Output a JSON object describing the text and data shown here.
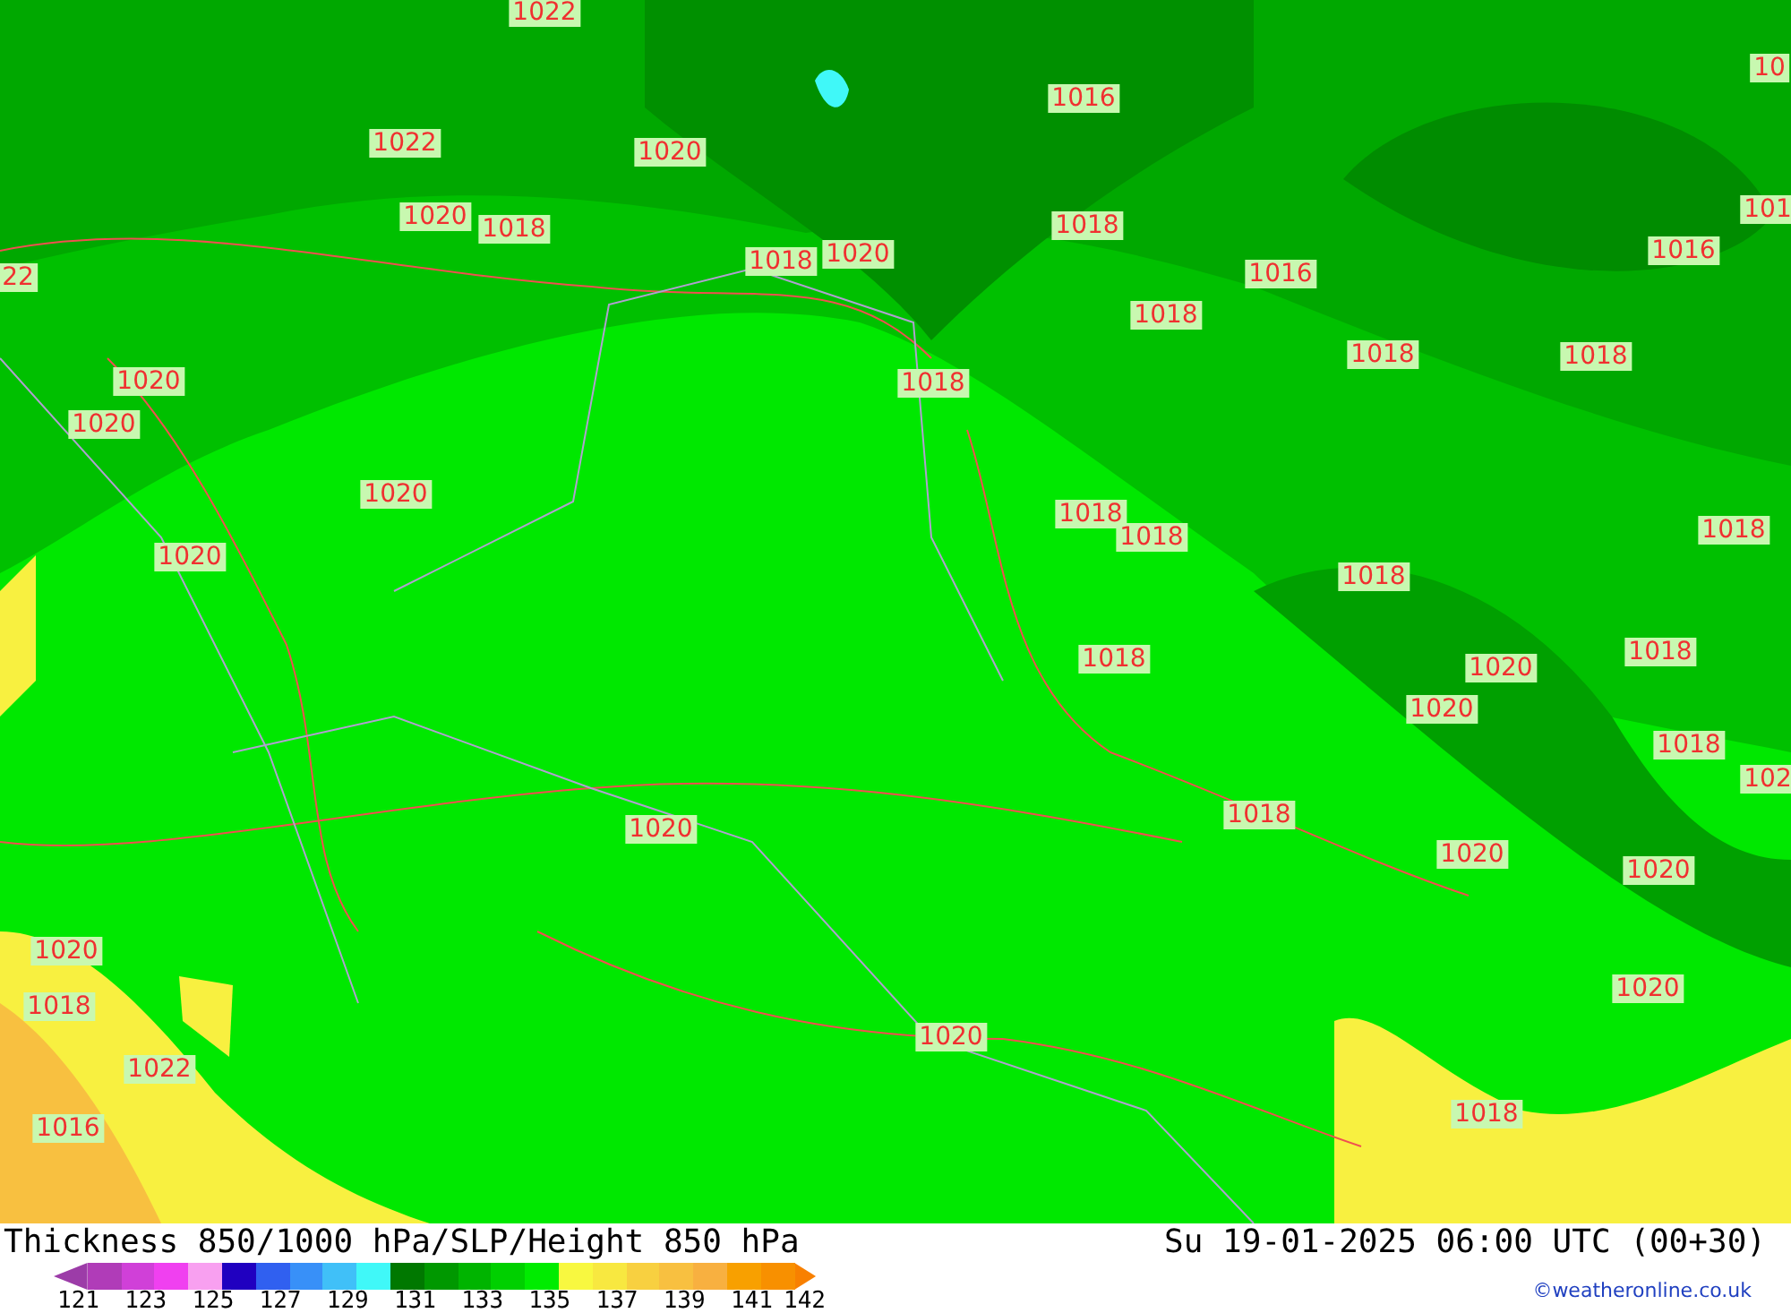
{
  "map": {
    "pressure_labels": [
      "1022",
      "10",
      "1016",
      "1022",
      "1020",
      "101",
      "1020",
      "1018",
      "1018",
      "1018",
      "1020",
      "1016",
      "22",
      "1016",
      "1018",
      "1018",
      "1018",
      "1020",
      "1018",
      "1020",
      "1020",
      "1018",
      "1018",
      "1018",
      "1020",
      "1018",
      "1018",
      "1018",
      "1020",
      "1020",
      "1018",
      "102",
      "1018",
      "1020",
      "1020",
      "1020",
      "1020",
      "1020",
      "1018",
      "1020",
      "1022",
      "1018",
      "1016"
    ]
  },
  "footer": {
    "title": "Thickness 850/1000 hPa/SLP/Height 850 hPa",
    "datetime": "Su 19-01-2025 06:00 UTC (00+30)",
    "credit": "©weatheronline.co.uk",
    "colorbar": {
      "segments": [
        {
          "color": "#9c3ca8"
        },
        {
          "color": "#b03cb8"
        },
        {
          "color": "#d040d8"
        },
        {
          "color": "#f040f0"
        },
        {
          "color": "#f8a0f0"
        },
        {
          "color": "#2000c0"
        },
        {
          "color": "#3060f0"
        },
        {
          "color": "#3890f8"
        },
        {
          "color": "#40c0f8"
        },
        {
          "color": "#40f8f8"
        },
        {
          "color": "#007800"
        },
        {
          "color": "#009800"
        },
        {
          "color": "#00b400"
        },
        {
          "color": "#00d000"
        },
        {
          "color": "#00ec00"
        },
        {
          "color": "#f8f840"
        },
        {
          "color": "#f8e840"
        },
        {
          "color": "#f8d040"
        },
        {
          "color": "#f8c040"
        },
        {
          "color": "#f8b040"
        },
        {
          "color": "#f8a000"
        },
        {
          "color": "#f89000"
        },
        {
          "color": "#f88000"
        }
      ],
      "ticks": [
        "121",
        "123",
        "125",
        "127",
        "129",
        "131",
        "133",
        "135",
        "137",
        "139",
        "141",
        "142"
      ]
    }
  }
}
